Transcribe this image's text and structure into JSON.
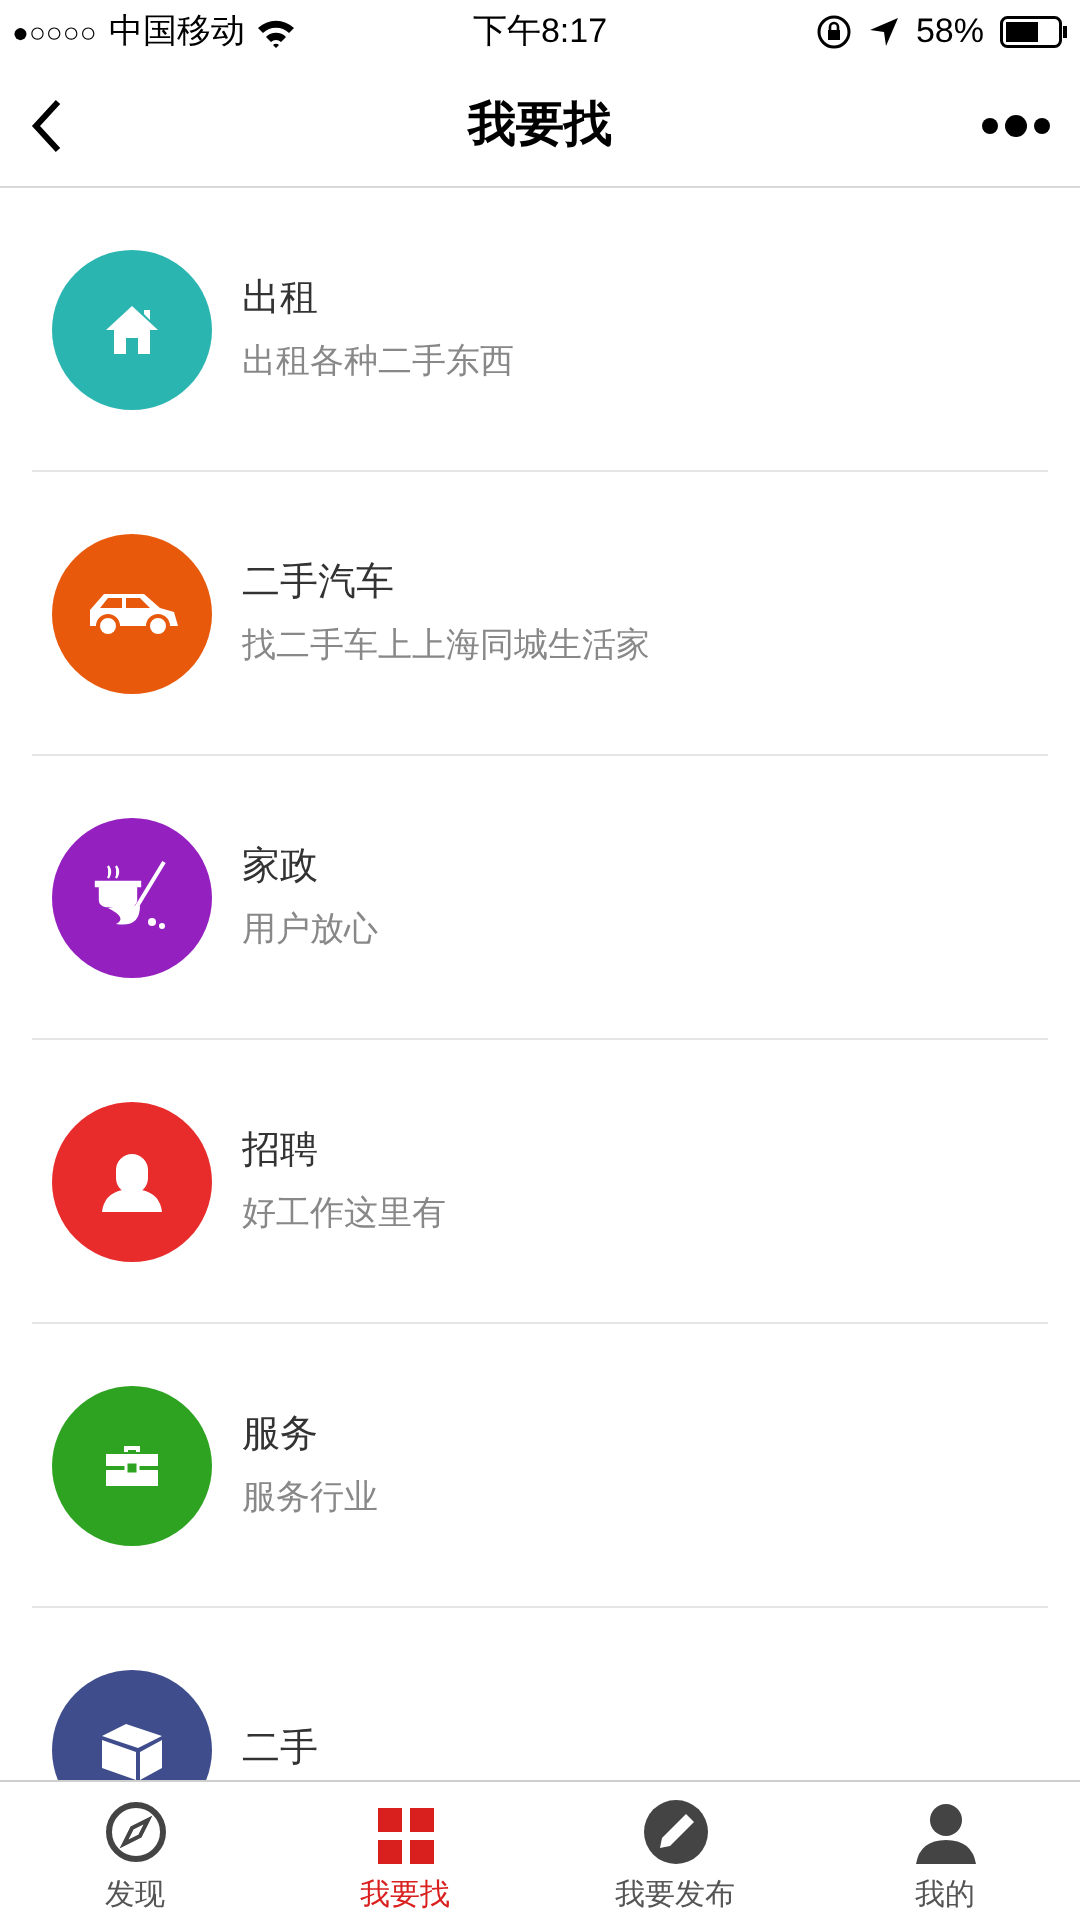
{
  "status_bar": {
    "signal": "●○○○○",
    "carrier": "中国移动",
    "time": "下午8:17",
    "battery": "58%"
  },
  "nav": {
    "title": "我要找"
  },
  "items": [
    {
      "kind": "house",
      "title": "出租",
      "subtitle": "出租各种二手东西",
      "color": "#2bb5b1"
    },
    {
      "kind": "car",
      "title": "二手汽车",
      "subtitle": "找二手车上上海同城生活家",
      "color": "#e8590c"
    },
    {
      "kind": "housework",
      "title": "家政",
      "subtitle": "用户放心",
      "color": "#9420c0"
    },
    {
      "kind": "person",
      "title": "招聘",
      "subtitle": "好工作这里有",
      "color": "#e82c2c"
    },
    {
      "kind": "briefcase",
      "title": "服务",
      "subtitle": "服务行业",
      "color": "#2ea322"
    },
    {
      "kind": "box",
      "title": "二手",
      "color": "#3f4d8c"
    }
  ],
  "tabs": [
    {
      "kind": "compass",
      "label": "发现",
      "selected": false
    },
    {
      "kind": "grid",
      "label": "我要找",
      "selected": true
    },
    {
      "kind": "pencil",
      "label": "我要发布",
      "selected": false
    },
    {
      "kind": "user",
      "label": "我的",
      "selected": false
    }
  ]
}
